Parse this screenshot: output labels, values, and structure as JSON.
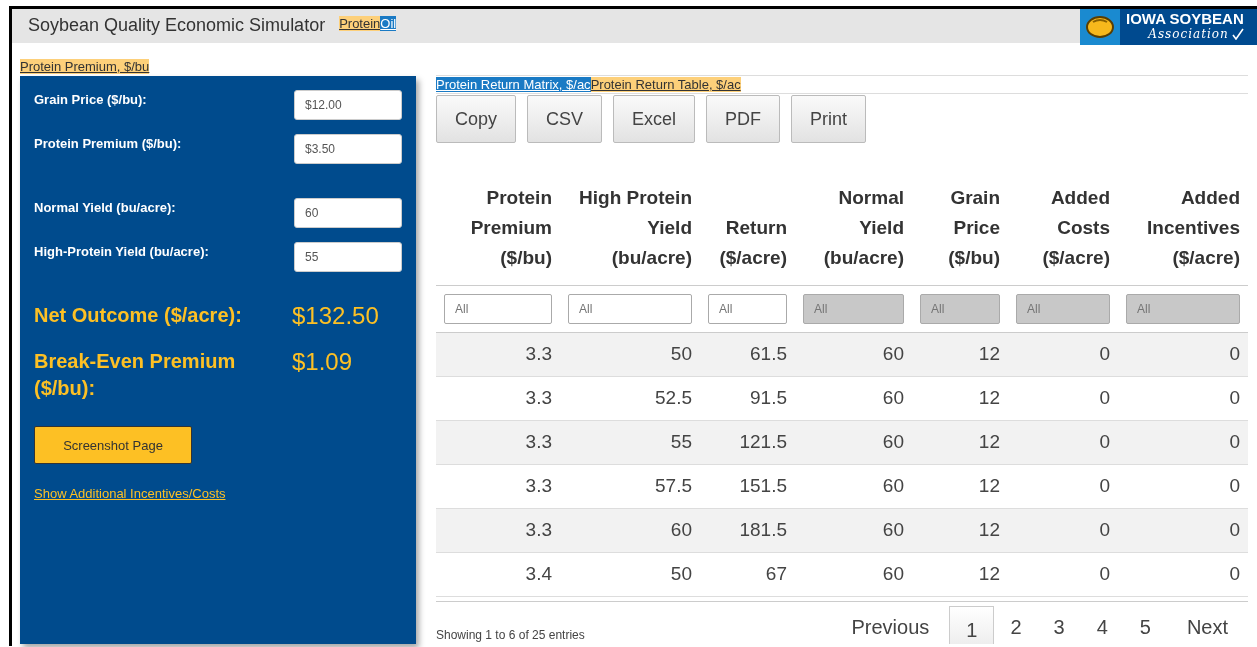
{
  "header": {
    "title": "Soybean Quality Economic Simulator",
    "tabs": [
      {
        "label": "Protein",
        "selected": true
      },
      {
        "label": "Oil",
        "selected": false
      }
    ],
    "logo": {
      "line1": "IOWA SOYBEAN",
      "line2": "Association"
    }
  },
  "sub_tabs": [
    {
      "label": "Protein Premium, $/bu",
      "selected": true
    }
  ],
  "inputs_panel": {
    "groups": [
      [
        {
          "label": "Grain Price ($/bu):",
          "value": "$12.00"
        },
        {
          "label": "Protein Premium ($/bu):",
          "value": "$3.50"
        }
      ],
      [
        {
          "label": "Normal Yield (bu/acre):",
          "value": "60"
        },
        {
          "label": "High-Protein Yield (bu/acre):",
          "value": "55"
        }
      ]
    ],
    "results": [
      {
        "label": "Net Outcome ($/acre):",
        "value": "$132.50"
      },
      {
        "label": "Break-Even Premium ($/bu):",
        "value": "$1.09"
      }
    ],
    "button": "Screenshot Page",
    "link": "Show Additional Incentives/Costs"
  },
  "table_tabs": [
    {
      "label": "Protein Return Matrix, $/ac",
      "selected": false
    },
    {
      "label": "Protein Return Table, $/ac",
      "selected": true
    }
  ],
  "export_buttons": [
    "Copy",
    "CSV",
    "Excel",
    "PDF",
    "Print"
  ],
  "table": {
    "columns": [
      "Protein Premium ($/bu)",
      "High Protein Yield (bu/acre)",
      "Return ($/acre)",
      "Normal Yield (bu/acre)",
      "Grain Price ($/bu)",
      "Added Costs ($/acre)",
      "Added Incentives ($/acre)"
    ],
    "filters": [
      {
        "placeholder": "All",
        "disabled": false
      },
      {
        "placeholder": "All",
        "disabled": false
      },
      {
        "placeholder": "All",
        "disabled": false
      },
      {
        "placeholder": "All",
        "disabled": true
      },
      {
        "placeholder": "All",
        "disabled": true
      },
      {
        "placeholder": "All",
        "disabled": true
      },
      {
        "placeholder": "All",
        "disabled": true
      }
    ],
    "rows": [
      [
        "3.3",
        "50",
        "61.5",
        "60",
        "12",
        "0",
        "0"
      ],
      [
        "3.3",
        "52.5",
        "91.5",
        "60",
        "12",
        "0",
        "0"
      ],
      [
        "3.3",
        "55",
        "121.5",
        "60",
        "12",
        "0",
        "0"
      ],
      [
        "3.3",
        "57.5",
        "151.5",
        "60",
        "12",
        "0",
        "0"
      ],
      [
        "3.3",
        "60",
        "181.5",
        "60",
        "12",
        "0",
        "0"
      ],
      [
        "3.4",
        "50",
        "67",
        "60",
        "12",
        "0",
        "0"
      ]
    ]
  },
  "footer": {
    "info": "Showing 1 to 6 of 25 entries",
    "pagination": [
      {
        "label": "Previous",
        "kind": "nav",
        "selected": false
      },
      {
        "label": "1",
        "kind": "page",
        "selected": true
      },
      {
        "label": "2",
        "kind": "page",
        "selected": false
      },
      {
        "label": "3",
        "kind": "page",
        "selected": false
      },
      {
        "label": "4",
        "kind": "page",
        "selected": false
      },
      {
        "label": "5",
        "kind": "page",
        "selected": false
      },
      {
        "label": "Next",
        "kind": "nav",
        "selected": false
      }
    ]
  }
}
